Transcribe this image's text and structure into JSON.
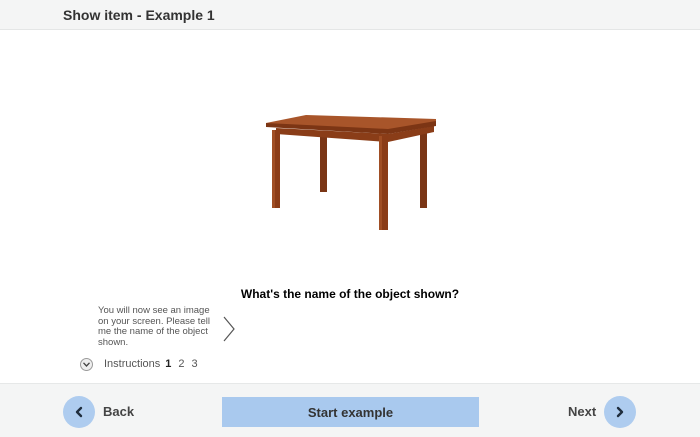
{
  "header": {
    "title": "Show item - Example 1"
  },
  "main": {
    "image_icon": "wooden-table",
    "question": "What's the name of the object shown?"
  },
  "instructions": {
    "text": "You will now see an image on your screen. Please tell me the name of the object shown.",
    "label": "Instructions",
    "pages": [
      "1",
      "2",
      "3"
    ],
    "current_page": "1"
  },
  "footer": {
    "back_label": "Back",
    "start_label": "Start example",
    "next_label": "Next",
    "accent_color": "#aeccef"
  }
}
